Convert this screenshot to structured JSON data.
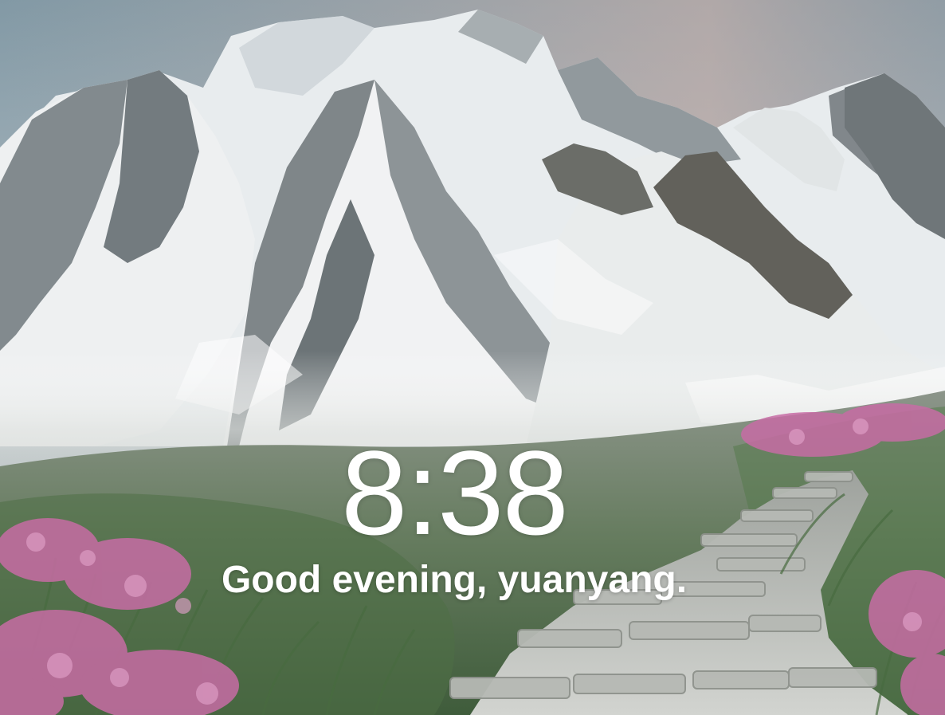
{
  "wallpaper": {
    "icon": "mountain-landscape-wallpaper",
    "colors": {
      "sky_top": "#7f95a1",
      "sky_glow": "#d7b8ae",
      "snow": "#f2f3f4",
      "rock": "#737b7f",
      "grass": "#5b7a55",
      "heather": "#c76ca4",
      "path_stone": "#c7c9c6"
    }
  },
  "clock": {
    "time": "8:38"
  },
  "greeting": {
    "text": "Good evening, yuanyang."
  }
}
